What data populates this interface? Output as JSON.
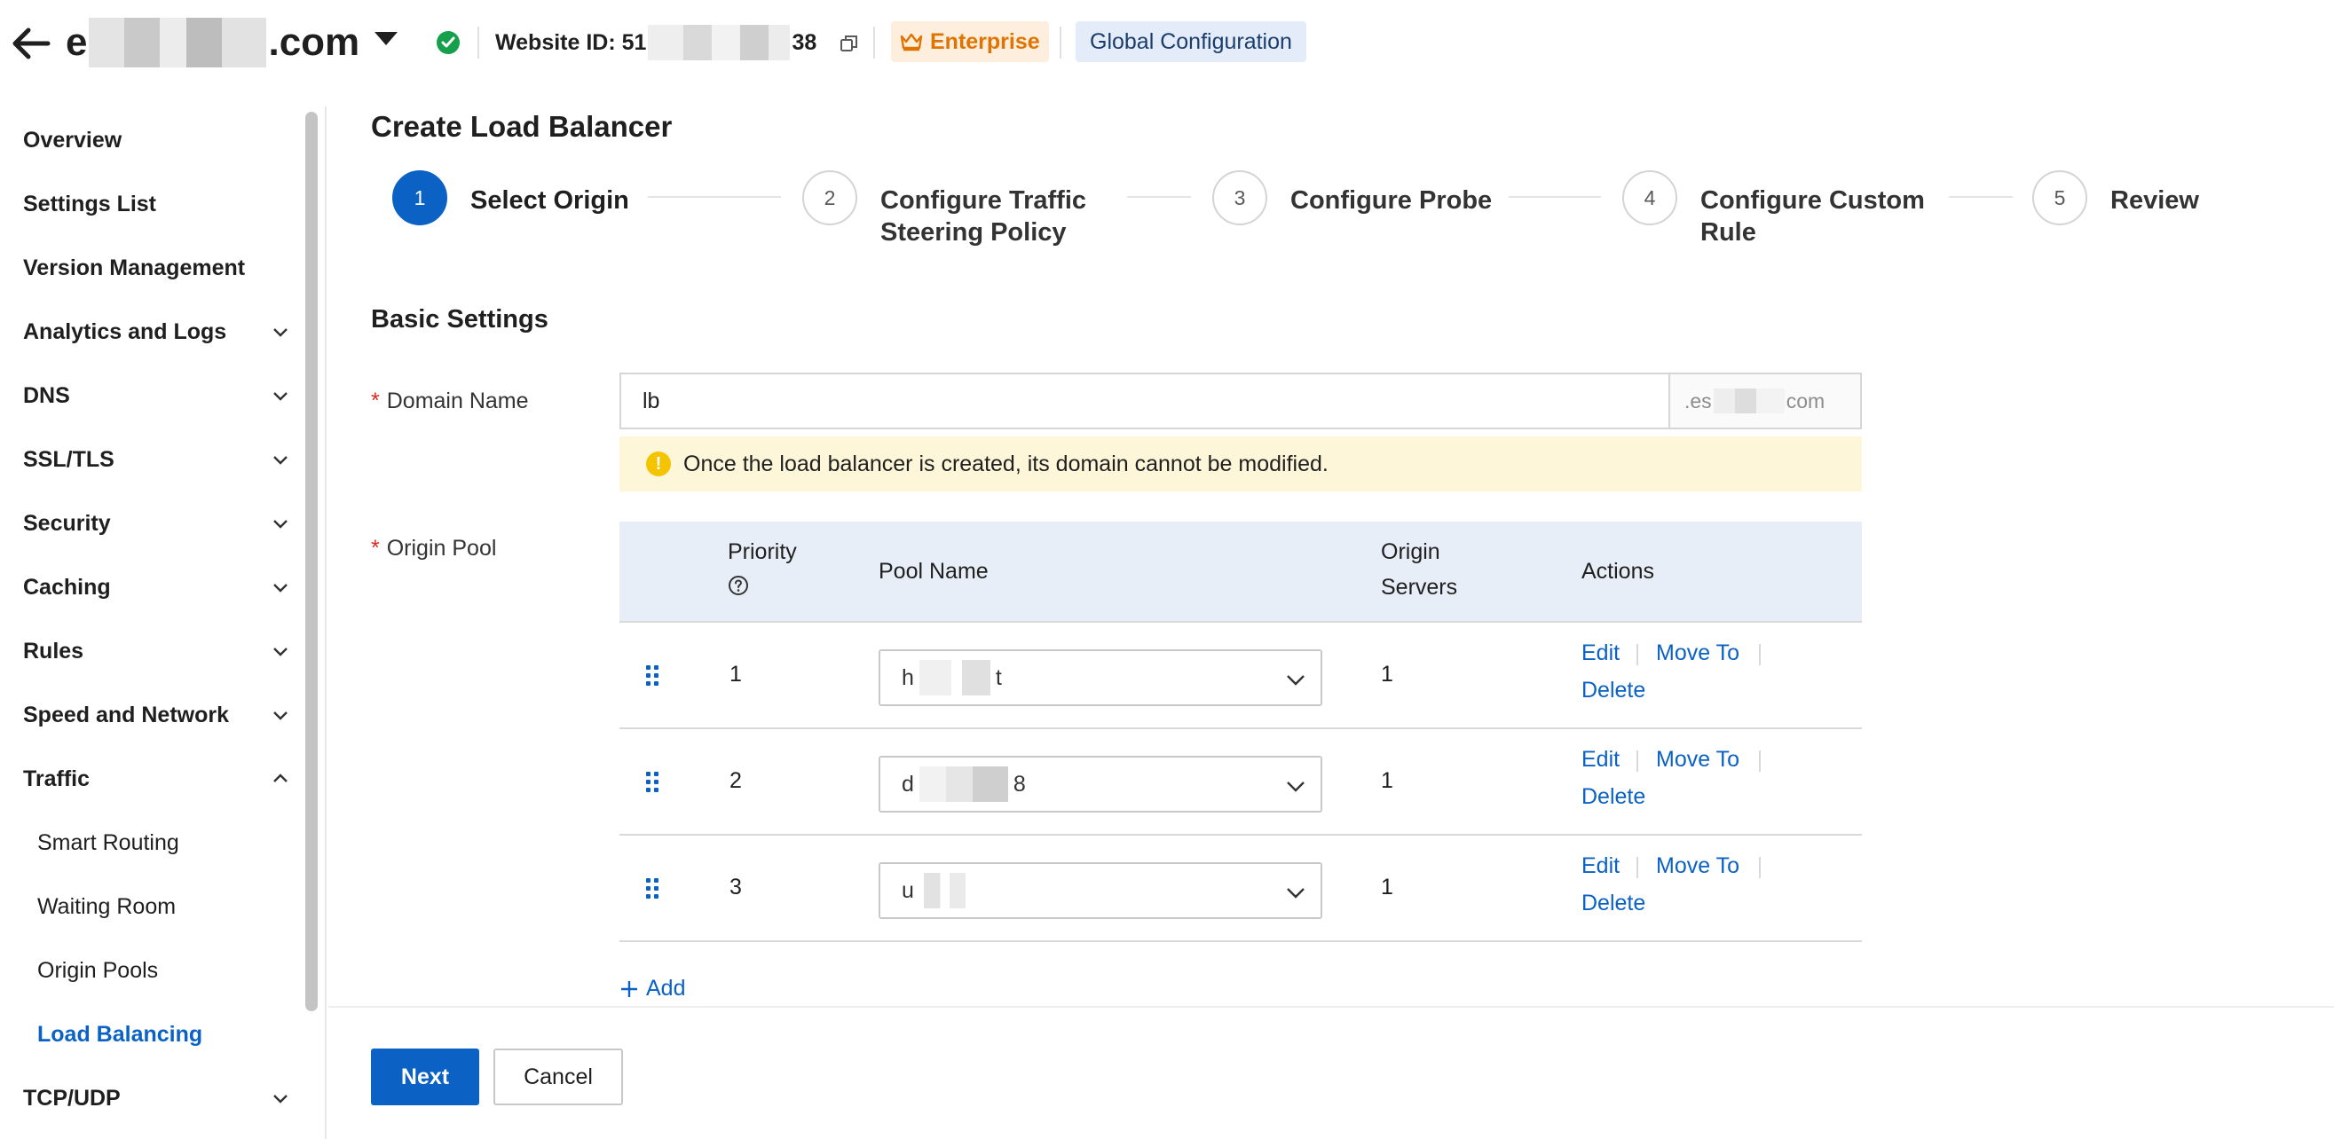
{
  "header": {
    "site_name_prefix": "e",
    "site_name_suffix": ".com",
    "website_id_prefix": "Website ID: 51",
    "website_id_suffix": "38",
    "plan_badge": "Enterprise",
    "global_config": "Global Configuration",
    "colors": {
      "status_ok": "#17a04b",
      "plan": "#e07400",
      "accent": "#0b62c4"
    },
    "icons": [
      "back-arrow-icon",
      "chevron-down-icon",
      "check-circle-icon",
      "copy-icon",
      "crown-icon"
    ]
  },
  "sidebar": {
    "items": [
      {
        "label": "Overview",
        "expandable": false
      },
      {
        "label": "Settings List",
        "expandable": false
      },
      {
        "label": "Version Management",
        "expandable": false
      },
      {
        "label": "Analytics and Logs",
        "expandable": true
      },
      {
        "label": "DNS",
        "expandable": true
      },
      {
        "label": "SSL/TLS",
        "expandable": true
      },
      {
        "label": "Security",
        "expandable": true
      },
      {
        "label": "Caching",
        "expandable": true
      },
      {
        "label": "Rules",
        "expandable": true
      },
      {
        "label": "Speed and Network",
        "expandable": true
      },
      {
        "label": "Traffic",
        "expandable": true,
        "expanded": true
      },
      {
        "label": "TCP/UDP",
        "expandable": true
      }
    ],
    "traffic_sub": [
      {
        "label": "Smart Routing",
        "active": false
      },
      {
        "label": "Waiting Room",
        "active": false
      },
      {
        "label": "Origin Pools",
        "active": false
      },
      {
        "label": "Load Balancing",
        "active": true
      }
    ]
  },
  "main": {
    "title": "Create Load Balancer",
    "steps": [
      {
        "num": "1",
        "label": "Select Origin",
        "active": true
      },
      {
        "num": "2",
        "label": "Configure Traffic Steering Policy",
        "line1": "Configure Traffic",
        "line2": "Steering Policy",
        "active": false
      },
      {
        "num": "3",
        "label": "Configure Probe",
        "active": false
      },
      {
        "num": "4",
        "label": "Configure Custom Rule",
        "line1": "Configure Custom",
        "line2": "Rule",
        "active": false
      },
      {
        "num": "5",
        "label": "Review",
        "active": false
      }
    ],
    "section_title": "Basic Settings",
    "domain": {
      "label": "Domain Name",
      "value": "lb",
      "suffix_prefix": ".es",
      "suffix_end": "com",
      "warning": "Once the load balancer is created, its domain cannot be modified."
    },
    "origin_pool": {
      "label": "Origin Pool",
      "columns": {
        "priority": "Priority",
        "pool_name": "Pool Name",
        "origin_servers_line1": "Origin",
        "origin_servers_line2": "Servers",
        "actions": "Actions"
      },
      "rows": [
        {
          "priority": "1",
          "pool_prefix": "h",
          "pool_suffix": "t",
          "servers": "1"
        },
        {
          "priority": "2",
          "pool_prefix": "d",
          "pool_suffix": "8",
          "servers": "1"
        },
        {
          "priority": "3",
          "pool_prefix": "u",
          "pool_suffix": "",
          "servers": "1"
        }
      ],
      "actions": {
        "edit": "Edit",
        "move_to": "Move To",
        "delete": "Delete"
      },
      "add_label": "Add"
    }
  },
  "footer": {
    "next": "Next",
    "cancel": "Cancel"
  }
}
